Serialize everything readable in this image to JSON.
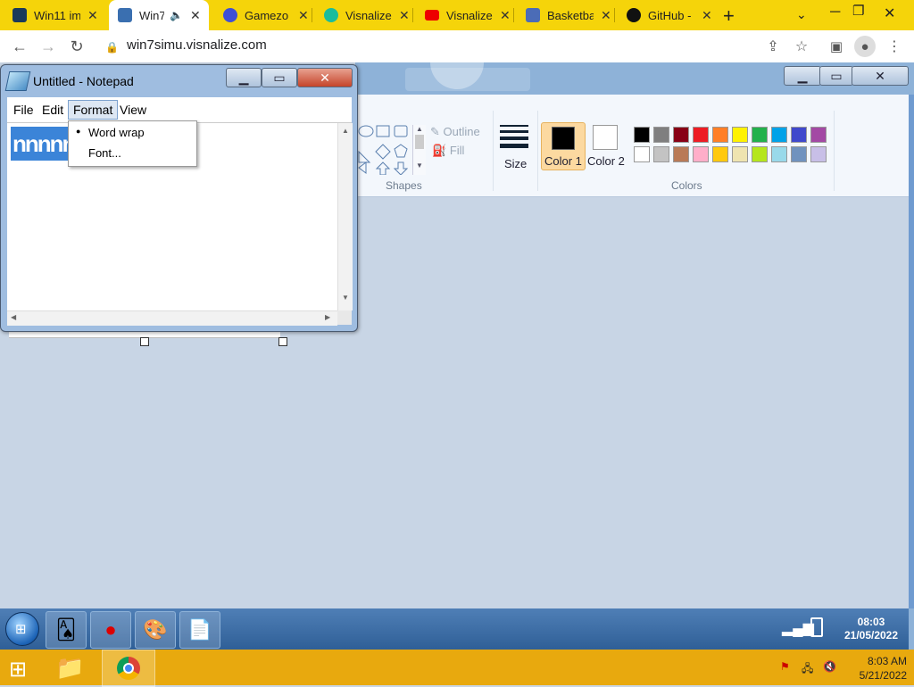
{
  "browser": {
    "tabs": [
      {
        "label": "Win11 im",
        "icon": "win11-icon",
        "color": "#1a3a5a"
      },
      {
        "label": "Win7",
        "icon": "win7-icon",
        "color": "#3a6fb0",
        "active": true
      },
      {
        "label": "Gamezo",
        "icon": "gamezop-icon",
        "color": "#3e4fd6"
      },
      {
        "label": "Visnalize",
        "icon": "visnalize-icon",
        "color": "#1abc9c"
      },
      {
        "label": "Visnalize",
        "icon": "youtube-icon",
        "color": "#e00"
      },
      {
        "label": "Basketba",
        "icon": "basketball-icon",
        "color": "#4b6cb7"
      },
      {
        "label": "GitHub -",
        "icon": "github-icon",
        "color": "#111"
      }
    ],
    "new_tab": "+",
    "url": "win7simu.visnalize.com"
  },
  "notepad": {
    "title": "Untitled - Notepad",
    "menu": [
      "File",
      "Edit",
      "Format",
      "View"
    ],
    "content": "nnnnn",
    "format_menu": [
      "Word wrap",
      "Font..."
    ]
  },
  "paint": {
    "outline_label": "Outline",
    "fill_label": "Fill",
    "shapes_label": "Shapes",
    "size_label": "Size",
    "color1_label": "Color 1",
    "color2_label": "Color 2",
    "colors_label": "Colors",
    "palette_row1": [
      "#000000",
      "#7f7f7f",
      "#880015",
      "#ed1c24",
      "#ff7f27",
      "#fff200",
      "#22b14c",
      "#00a2e8",
      "#3f48cc",
      "#a349a4"
    ],
    "palette_row2": [
      "#ffffff",
      "#c3c3c3",
      "#b97a57",
      "#ffaec9",
      "#ffc90e",
      "#efe4b0",
      "#b5e61d",
      "#99d9ea",
      "#7092be",
      "#c8bfe7"
    ]
  },
  "win7_taskbar": {
    "time": "08:03",
    "date": "21/05/2022"
  },
  "win8_taskbar": {
    "time": "8:03 AM",
    "date": "5/21/2022"
  }
}
